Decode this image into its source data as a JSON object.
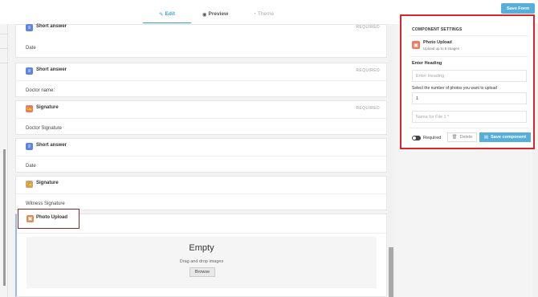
{
  "header": {
    "tabs": [
      {
        "label": "Edit",
        "icon": "pencil-icon",
        "active": true
      },
      {
        "label": "Preview",
        "icon": "eye-icon",
        "active": false
      },
      {
        "label": "Theme",
        "icon": "palette-icon",
        "active": false,
        "disabled": true
      }
    ],
    "save_form": "Save Form"
  },
  "form": {
    "cards": [
      {
        "type": "Short answer",
        "required": "REQUIRED",
        "label": "Date",
        "icon": "text-icon",
        "color": "#5d84e0"
      },
      {
        "type": "Short answer",
        "required": "REQUIRED",
        "label": "Doctor name:",
        "icon": "text-icon",
        "color": "#5d84e0"
      },
      {
        "type": "Signature",
        "required": "REQUIRED",
        "label": "Doctor Signature",
        "icon": "signature-icon",
        "color": "#ee7a60"
      },
      {
        "type": "Short answer",
        "required": "",
        "label": "Date",
        "icon": "text-icon",
        "color": "#5d84e0"
      },
      {
        "type": "Signature",
        "required": "",
        "label": "Witness Signature",
        "icon": "signature-icon",
        "color": "#d2a264"
      }
    ],
    "photo": {
      "type": "Photo Upload",
      "icon": "image-icon",
      "dropzone": {
        "title": "Empty",
        "subtitle": "Drag and drop images",
        "browse": "Browse"
      }
    }
  },
  "settings": {
    "title": "COMPONENT SETTINGS",
    "component_name": "Photo Upload",
    "component_sub": "Upload up to 6 images",
    "heading_label": "Enter Heading",
    "heading_placeholder": "Enter Heading",
    "photos_label": "Select the number of photos you want to upload",
    "photos_value": "1",
    "file_placeholder": "Name for File 1 *",
    "required_label": "Required",
    "delete_label": "Delete",
    "save_label": "Save component"
  },
  "colors": {
    "accent": "#58aedb",
    "highlight": "#d9262a",
    "selection": "#8e2a2a"
  }
}
